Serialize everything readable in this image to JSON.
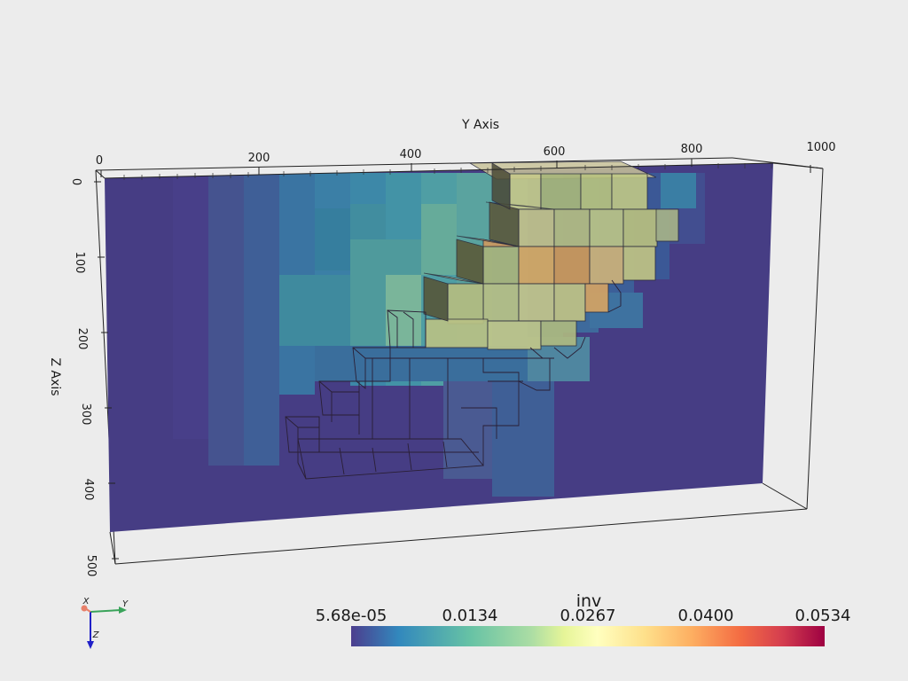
{
  "scene": {
    "y_axis_title": "Y Axis",
    "z_axis_title": "Z Axis",
    "y_ticks": [
      "0",
      "200",
      "400",
      "600",
      "800",
      "1000"
    ],
    "z_ticks": [
      "0",
      "100",
      "200",
      "300",
      "400",
      "500"
    ],
    "background": "#ececec"
  },
  "colorbar": {
    "title": "inv",
    "ticks": [
      "5.68e-05",
      "0.0134",
      "0.0267",
      "0.0400",
      "0.0534"
    ],
    "colormap": "Spectral_r",
    "stops": [
      "#4c3e8e",
      "#3288bd",
      "#66c2a5",
      "#abdda4",
      "#e6f598",
      "#ffffbf",
      "#fee08b",
      "#fdae61",
      "#f46d43",
      "#d53e4f",
      "#9e0142"
    ]
  },
  "orientation_widget": {
    "x_label": "X",
    "y_label": "Y",
    "z_label": "Z",
    "x_color": "#e8806a",
    "y_color": "#3aa35a",
    "z_color": "#2020c8"
  }
}
